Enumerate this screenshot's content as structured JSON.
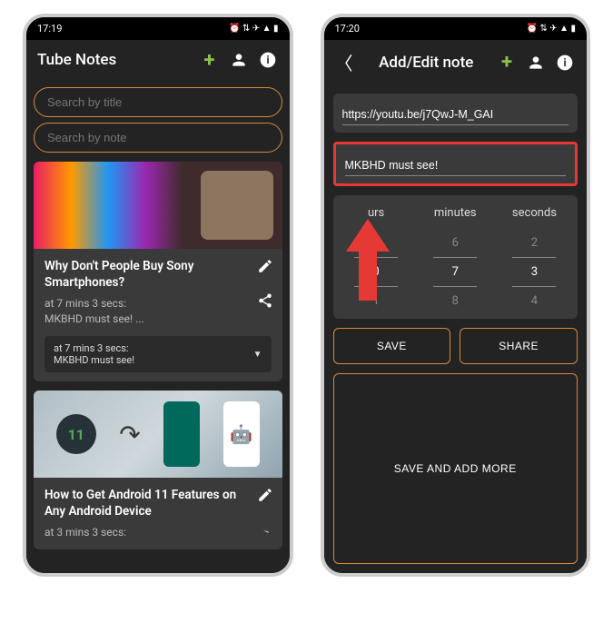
{
  "left": {
    "status_time": "17:19",
    "title": "Tube Notes",
    "search_title_ph": "Search by title",
    "search_note_ph": "Search by note",
    "cards": [
      {
        "title": "Why Don't People Buy Sony Smartphones?",
        "meta": "at  7 mins 3 secs:\nMKBHD must see! ...",
        "pill": "at  7 mins 3 secs:\nMKBHD must see!"
      },
      {
        "title": "How to Get Android 11 Features on Any Android Device",
        "meta": "at  3 mins 3 secs:"
      }
    ]
  },
  "right": {
    "status_time": "17:20",
    "title": "Add/Edit note",
    "url": "https://youtu.be/j7QwJ-M_GAI",
    "note": "MKBHD must see!",
    "picker": {
      "labels": [
        "urs",
        "minutes",
        "seconds"
      ],
      "cols": [
        [
          "71",
          "0",
          "1"
        ],
        [
          "6",
          "7",
          "8"
        ],
        [
          "2",
          "3",
          "4"
        ]
      ]
    },
    "btn_save": "SAVE",
    "btn_share": "SHARE",
    "btn_more": "SAVE AND ADD MORE"
  }
}
